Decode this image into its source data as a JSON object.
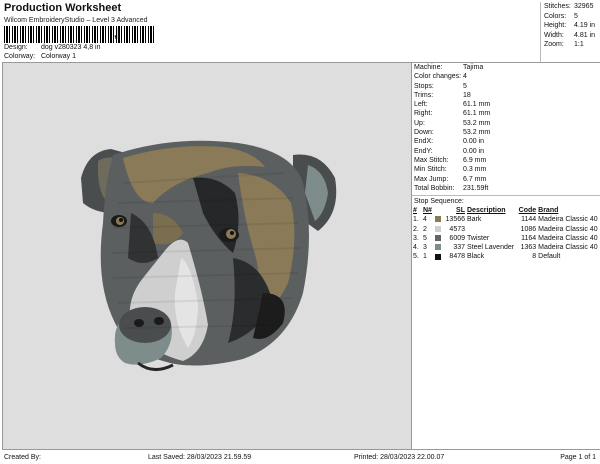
{
  "header": {
    "title": "Production Worksheet",
    "software": "Wilcom EmbroideryStudio – Level 3 Advanced",
    "barcode_tail": ",|",
    "design_label": "Design:",
    "design_value": "dog v280323 4,8 in",
    "colorway_label": "Colorway:",
    "colorway_value": "Colorway 1"
  },
  "stats": [
    {
      "label": "Stitches:",
      "value": "32965"
    },
    {
      "label": "Colors:",
      "value": "5"
    },
    {
      "label": "Height:",
      "value": "4.19 in"
    },
    {
      "label": "Width:",
      "value": "4.81 in"
    },
    {
      "label": "Zoom:",
      "value": "1:1"
    }
  ],
  "machine_info": [
    {
      "label": "Machine:",
      "value": "Tajima"
    },
    {
      "label": "Color changes:",
      "value": "4"
    },
    {
      "label": "Stops:",
      "value": "5"
    },
    {
      "label": "Trims:",
      "value": "18"
    },
    {
      "label": "Left:",
      "value": "61.1 mm"
    },
    {
      "label": "Right:",
      "value": "61.1 mm"
    },
    {
      "label": "Up:",
      "value": "53.2 mm"
    },
    {
      "label": "Down:",
      "value": "53.2 mm"
    },
    {
      "label": "EndX:",
      "value": "0.00 in"
    },
    {
      "label": "EndY:",
      "value": "0.00 in"
    },
    {
      "label": "Max Stitch:",
      "value": "6.9 mm"
    },
    {
      "label": "Min Stitch:",
      "value": "0.3 mm"
    },
    {
      "label": "Max Jump:",
      "value": "6.7 mm"
    },
    {
      "label": "Total Bobbin:",
      "value": "231.59ft"
    }
  ],
  "stop_sequence": {
    "title": "Stop Sequence:",
    "headers": [
      "#",
      "N#",
      "",
      "SL",
      "Description",
      "Code",
      "Brand"
    ],
    "rows": [
      {
        "num": "1.",
        "n": "4",
        "color": "#8a7a58",
        "sl": "13566",
        "desc": "Bark",
        "code": "1144",
        "brand": "Madeira Classic 40"
      },
      {
        "num": "2.",
        "n": "2",
        "color": "#cfcfcf",
        "sl": "4573",
        "desc": "",
        "code": "1086",
        "brand": "Madeira Classic 40"
      },
      {
        "num": "3.",
        "n": "5",
        "color": "#606468",
        "sl": "6009",
        "desc": "Twister",
        "code": "1164",
        "brand": "Madeira Classic 40"
      },
      {
        "num": "4.",
        "n": "3",
        "color": "#7f8c8c",
        "sl": "337",
        "desc": "Steel Lavender",
        "code": "1363",
        "brand": "Madeira Classic 40"
      },
      {
        "num": "5.",
        "n": "1",
        "color": "#111111",
        "sl": "8478",
        "desc": "Black",
        "code": "8",
        "brand": "Default"
      }
    ]
  },
  "footer": {
    "created": "Created By:",
    "saved": "Last Saved: 28/03/2023 21.59.59",
    "printed": "Printed: 28/03/2023 22.00.07",
    "page": "Page 1 of 1"
  },
  "colors": {
    "canvas": "#dedede",
    "bark": "#8a7a58",
    "twister": "#606468",
    "steel_lavender": "#7f8c8c",
    "light": "#cfcfcf",
    "black": "#111111"
  }
}
